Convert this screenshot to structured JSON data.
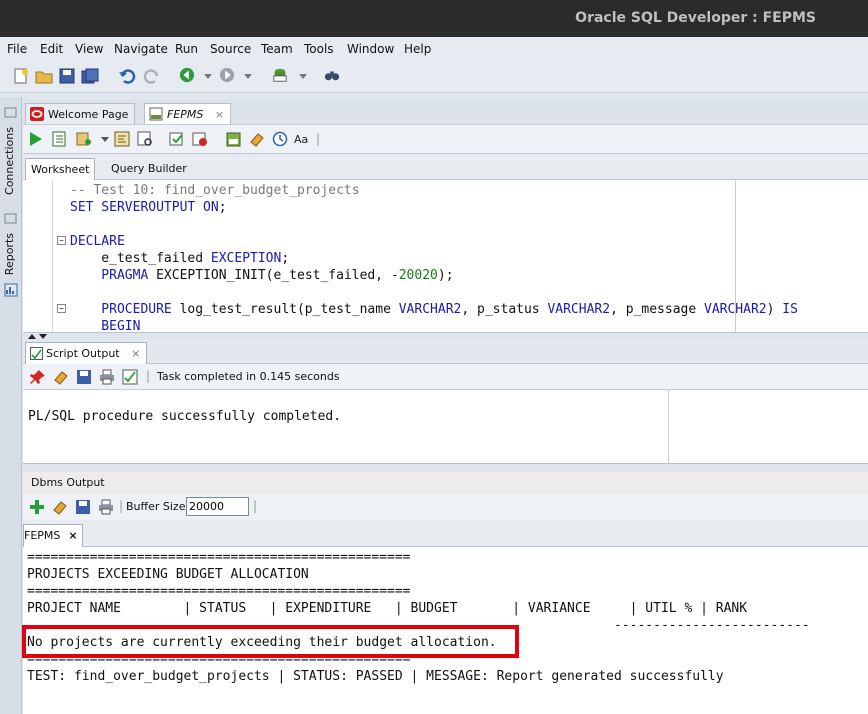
{
  "window": {
    "title": "Oracle SQL Developer : FEPMS"
  },
  "menu": [
    "File",
    "Edit",
    "View",
    "Navigate",
    "Run",
    "Source",
    "Team",
    "Tools",
    "Window",
    "Help"
  ],
  "left_panel": {
    "connections": "Connections",
    "reports": "Reports"
  },
  "doc_tabs": [
    {
      "label": "Welcome Page"
    },
    {
      "label": "FEPMS"
    }
  ],
  "sub_tabs": [
    "Worksheet",
    "Query Builder"
  ],
  "editor_text": {
    "l1": "-- Test 10: find_over_budget_projects",
    "l2_kw": "SET SERVEROUTPUT ON",
    "l2_end": ";",
    "l3": "DECLARE",
    "l4_a": "    e_test_failed ",
    "l4_kw": "EXCEPTION",
    "l4_end": ";",
    "l5_kw": "    PRAGMA",
    "l5_mid": " EXCEPTION_INIT(e_test_failed, -",
    "l5_num": "20020",
    "l5_end": ");",
    "l6_kw": "    PROCEDURE",
    "l6_a": " log_test_result(p_test_name ",
    "l6_t1": "VARCHAR2",
    "l6_b": ", p_status ",
    "l6_t2": "VARCHAR2",
    "l6_c": ", p_message ",
    "l6_t3": "VARCHAR2",
    "l6_d": ") ",
    "l6_kw2": "IS",
    "l7": "    BEGIN"
  },
  "script_output": {
    "tab_label": "Script Output",
    "status": "Task completed in 0.145 seconds",
    "text": "PL/SQL procedure successfully completed."
  },
  "dbms_output": {
    "title": "Dbms Output",
    "buffer_label": "Buffer Size:",
    "buffer_value": "20000",
    "tab_label": "FEPMS",
    "lines": {
      "rule1": "=================================================",
      "heading": "PROJECTS EXCEEDING BUDGET ALLOCATION",
      "rule2": "=================================================",
      "columns": "PROJECT NAME        | STATUS   | EXPENDITURE   | BUDGET       | VARIANCE     | UTIL % | RANK",
      "dashes": "                                                                           -------------------------",
      "message": "No projects are currently exceeding their budget allocation.",
      "rule3": "=================================================",
      "result": "TEST: find_over_budget_projects | STATUS: PASSED | MESSAGE: Report generated successfully"
    }
  },
  "colors": {
    "highlight": "#e3000f",
    "keyword": "#1a1ab0",
    "titlebar": "#2b2b2b"
  }
}
